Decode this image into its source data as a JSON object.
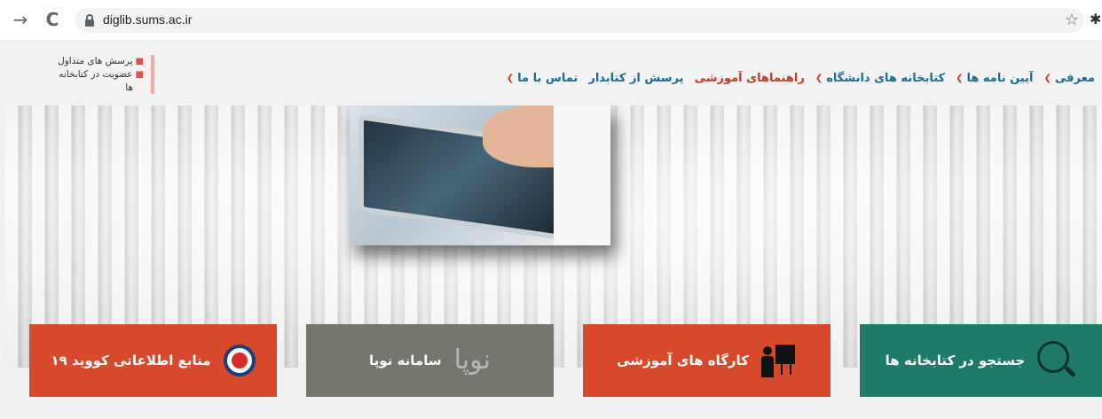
{
  "browser": {
    "url": "diglib.sums.ac.ir"
  },
  "sidenote": {
    "items": [
      "پرسش های متداول",
      "عضویت در کتابخانه",
      "ها"
    ]
  },
  "nav": {
    "items": [
      {
        "label": "معرفی",
        "dropdown": true
      },
      {
        "label": "آیین نامه ها",
        "dropdown": true
      },
      {
        "label": "کتابخانه های دانشگاه",
        "dropdown": true
      },
      {
        "label": "راهنماهای آموزشی",
        "dropdown": false,
        "color": "#c0392b"
      },
      {
        "label": "پرسش از کتابدار",
        "dropdown": false
      },
      {
        "label": "تماس با ما",
        "dropdown": true
      }
    ]
  },
  "tiles": [
    {
      "label": "جستجو در کتابخانه ها",
      "color": "#1f7a6b",
      "icon": "search-icon"
    },
    {
      "label": "کارگاه های آموزشی",
      "color": "#d6492a",
      "icon": "teacher-icon"
    },
    {
      "label": "سامانه نوپا",
      "logo_text": "نوپا",
      "color": "#74766d",
      "icon": "noopa-logo"
    },
    {
      "label": "منابع اطلاعاتی کووید ۱۹",
      "color": "#d6492a",
      "icon": "corona-virus-icon"
    }
  ]
}
